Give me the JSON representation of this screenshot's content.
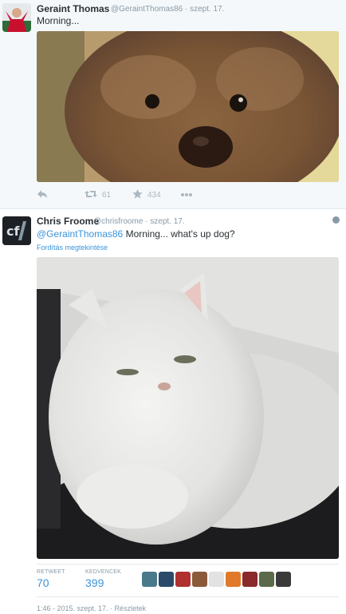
{
  "tweet1": {
    "name": "Geraint Thomas",
    "handle": "@GeraintThomas86 · szept. 17.",
    "text": "Morning...",
    "retweet_count": "61",
    "favorite_count": "434"
  },
  "tweet2": {
    "name": "Chris Froome",
    "handle": "@chrisfroome · szept. 17.",
    "mention": "@GeraintThomas86",
    "text": " Morning... what's up dog?",
    "translate": "Fordítás megtekintése",
    "retweet_label": "RETWEET",
    "retweet_value": "70",
    "favorites_label": "KEDVENCEK",
    "favorites_value": "399",
    "timestamp": "1:46 - 2015. szept. 17. · Részletek"
  },
  "colors": {
    "accent": "#3b94d9",
    "muted": "#8899a6",
    "text": "#292f33"
  },
  "icons": [
    "reply-icon",
    "retweet-icon",
    "star-icon",
    "more-icon",
    "globe-icon"
  ]
}
